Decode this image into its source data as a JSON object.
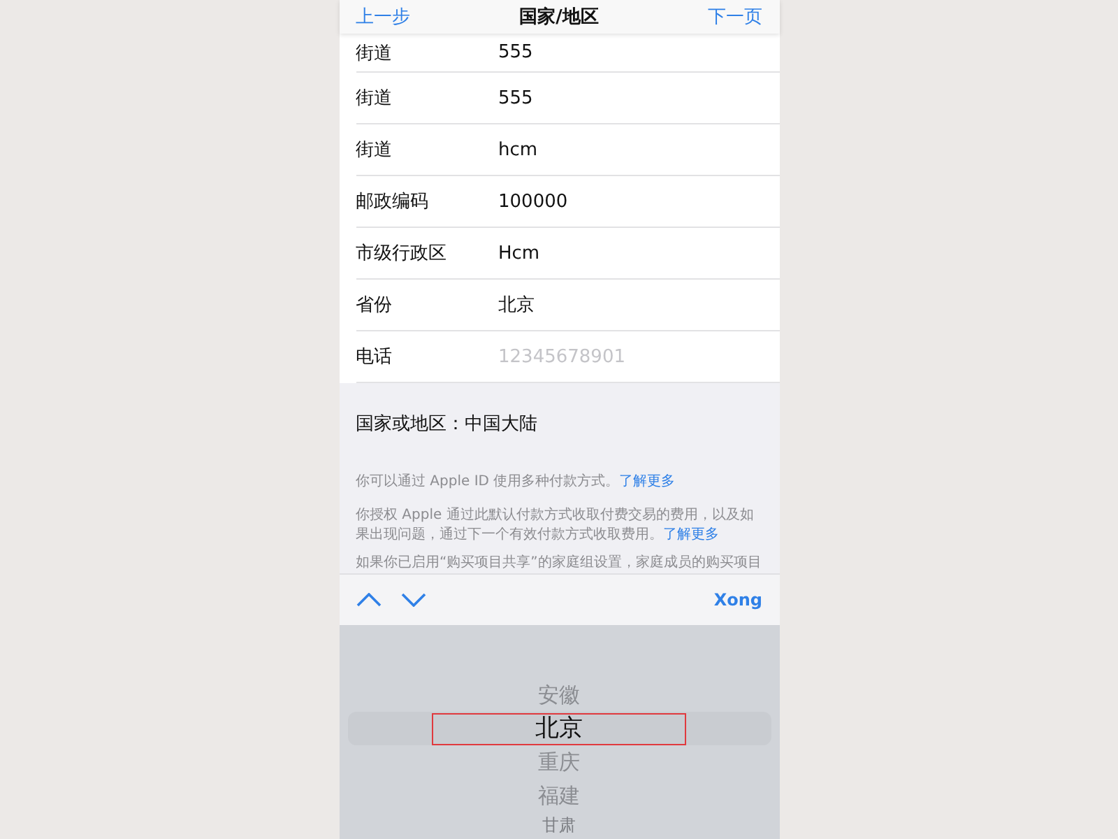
{
  "nav_bar": {
    "back": "上一步",
    "title": "国家/地区",
    "next": "下一页"
  },
  "form_rows": [
    {
      "label": "街道",
      "value": "555",
      "kind": "value"
    },
    {
      "label": "街道",
      "value": "555",
      "kind": "value"
    },
    {
      "label": "街道",
      "value": "hcm",
      "kind": "value"
    },
    {
      "label": "邮政编码",
      "value": "100000",
      "kind": "value"
    },
    {
      "label": "市级行政区",
      "value": "Hcm",
      "kind": "value"
    },
    {
      "label": "省份",
      "value": "北京",
      "kind": "value"
    },
    {
      "label": "电话",
      "placeholder": "12345678901",
      "kind": "placeholder"
    }
  ],
  "country": "国家或地区：中国大陆",
  "notes": [
    {
      "text": "你可以通过 Apple ID 使用多种付款方式。",
      "link": "了解更多"
    },
    {
      "text": "你授权 Apple 通过此默认付款方式收取付费交易的费用，以及如果出现问题，通过下一个有效付款方式收取费用。",
      "link": "了解更多"
    },
    {
      "text": "如果你已启用“购买项目共享”的家庭组设置，家庭成员的购买项目"
    }
  ],
  "toolbar": {
    "done": "Xong"
  },
  "picker": [
    {
      "label": "安徽",
      "selected": false
    },
    {
      "label": "北京",
      "selected": true
    },
    {
      "label": "重庆",
      "selected": false
    },
    {
      "label": "福建",
      "selected": false
    },
    {
      "label": "甘肃",
      "selected": false
    }
  ]
}
